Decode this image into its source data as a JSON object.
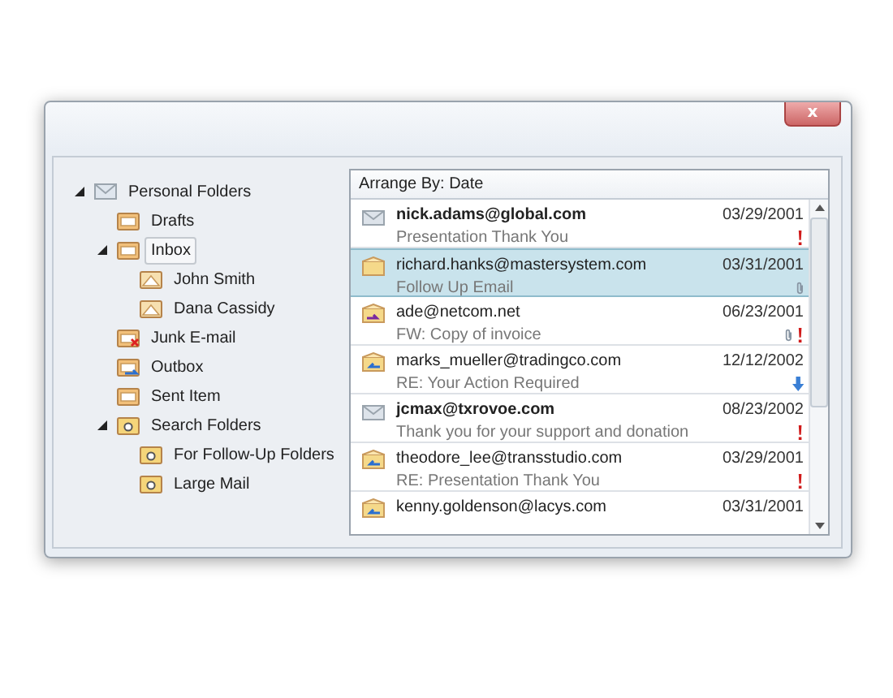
{
  "window": {
    "close_label": "x"
  },
  "tree": [
    {
      "label": "Personal Folders",
      "kind": "mail",
      "expanded": true,
      "selected": false,
      "children": [
        {
          "label": "Drafts",
          "kind": "folder",
          "selected": false
        },
        {
          "label": "Inbox",
          "kind": "folder",
          "expanded": true,
          "selected": true,
          "children": [
            {
              "label": "John Smith",
              "kind": "contact",
              "selected": false
            },
            {
              "label": "Dana Cassidy",
              "kind": "contact",
              "selected": false
            }
          ]
        },
        {
          "label": "Junk E-mail",
          "kind": "junk",
          "selected": false
        },
        {
          "label": "Outbox",
          "kind": "outbox",
          "selected": false
        },
        {
          "label": "Sent Item",
          "kind": "folder",
          "selected": false
        },
        {
          "label": "Search Folders",
          "kind": "search",
          "expanded": true,
          "selected": false,
          "children": [
            {
              "label": "For Follow-Up Folders",
              "kind": "search",
              "selected": false
            },
            {
              "label": "Large Mail",
              "kind": "search",
              "selected": false
            }
          ]
        }
      ]
    }
  ],
  "list": {
    "header": "Arrange By: Date",
    "rows": [
      {
        "from": "nick.adams@global.com",
        "date": "03/29/2001",
        "subject": "Presentation Thank You",
        "unread": true,
        "selected": false,
        "kind": "read",
        "marks": [
          {
            "kind": "important"
          }
        ]
      },
      {
        "from": "richard.hanks@mastersystem.com",
        "date": "03/31/2001",
        "subject": "Follow Up Email",
        "unread": false,
        "selected": true,
        "kind": "open",
        "marks": [
          {
            "kind": "attachment"
          }
        ]
      },
      {
        "from": "ade@netcom.net",
        "date": "06/23/2001",
        "subject": "FW: Copy of invoice",
        "unread": false,
        "selected": false,
        "kind": "forward",
        "marks": [
          {
            "kind": "attachment"
          },
          {
            "kind": "important"
          }
        ]
      },
      {
        "from": "marks_mueller@tradingco.com",
        "date": "12/12/2002",
        "subject": "RE: Your Action Required",
        "unread": false,
        "selected": false,
        "kind": "reply",
        "marks": [
          {
            "kind": "low"
          }
        ]
      },
      {
        "from": "jcmax@txrovoe.com",
        "date": "08/23/2002",
        "subject": "Thank you for your support and donation",
        "unread": true,
        "selected": false,
        "kind": "read",
        "marks": [
          {
            "kind": "important"
          }
        ]
      },
      {
        "from": "theodore_lee@transstudio.com",
        "date": "03/29/2001",
        "subject": "RE: Presentation Thank You",
        "unread": false,
        "selected": false,
        "kind": "reply",
        "marks": [
          {
            "kind": "important"
          }
        ]
      },
      {
        "from": "kenny.goldenson@lacys.com",
        "date": "03/31/2001",
        "unread": false,
        "selected": false,
        "kind": "reply"
      }
    ]
  }
}
